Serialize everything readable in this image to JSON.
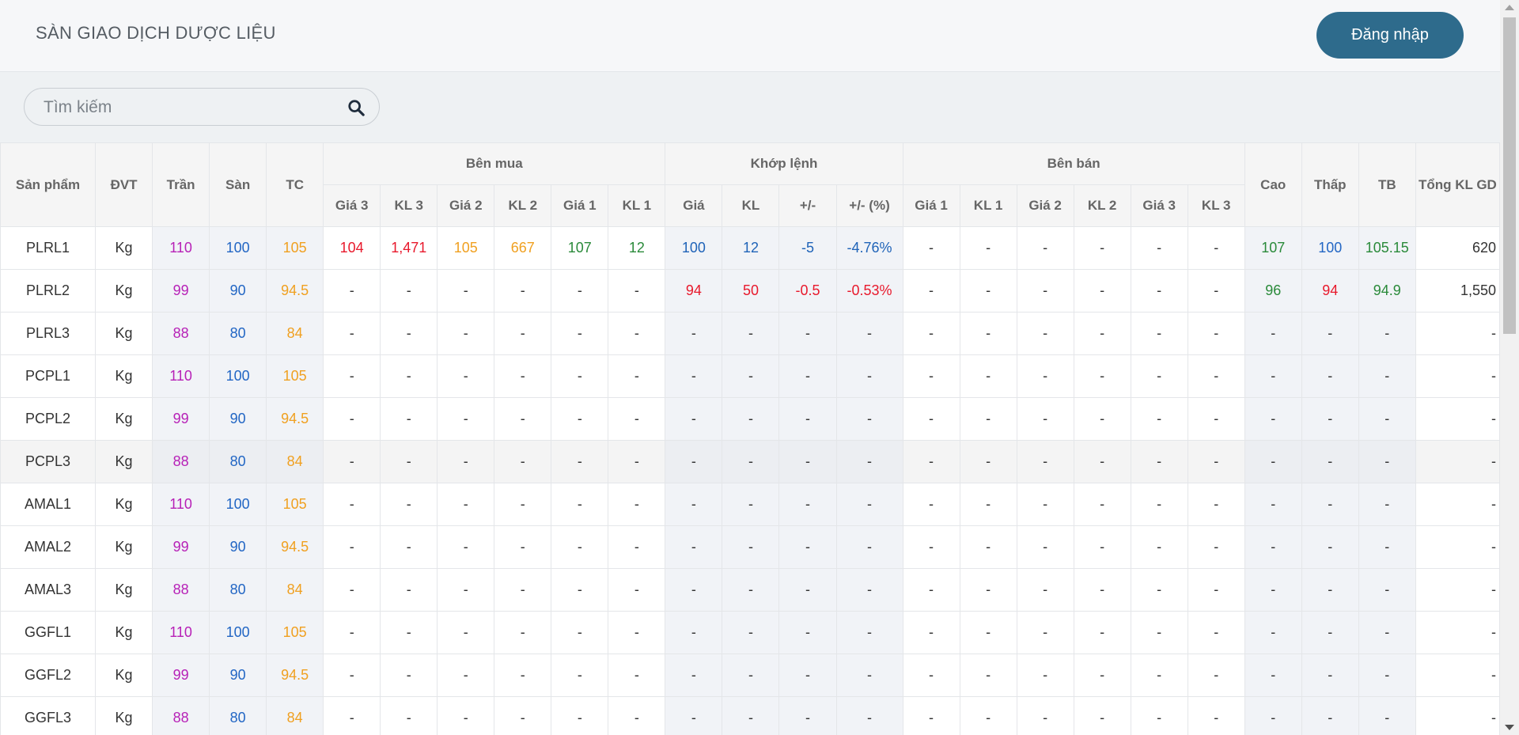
{
  "header": {
    "title": "SÀN GIAO DỊCH DƯỢC LIỆU",
    "login_label": "Đăng nhập"
  },
  "search": {
    "placeholder": "Tìm kiếm"
  },
  "table": {
    "group_headers": {
      "buy": "Bên mua",
      "match": "Khớp lệnh",
      "sell": "Bên bán"
    },
    "fixed_headers": {
      "product": "Sản phẩm",
      "unit": "ĐVT",
      "ceiling": "Trần",
      "floor": "Sàn",
      "ref": "TC",
      "high": "Cao",
      "low": "Thấp",
      "avg": "TB",
      "total": "Tổng KL GD"
    },
    "buy_cols": [
      "Giá 3",
      "KL 3",
      "Giá 2",
      "KL 2",
      "Giá 1",
      "KL 1"
    ],
    "match_cols": [
      "Giá",
      "KL",
      "+/-",
      "+/- (%)"
    ],
    "sell_cols": [
      "Giá 1",
      "KL 1",
      "Giá 2",
      "KL 2",
      "Giá 3",
      "KL 3"
    ],
    "rows": [
      {
        "product": "PLRL1",
        "unit": "Kg",
        "ceiling": "110",
        "floor": "100",
        "ref": "105",
        "buy": [
          "104",
          "1,471",
          "105",
          "667",
          "107",
          "12"
        ],
        "match": [
          "100",
          "12",
          "-5",
          "-4.76%"
        ],
        "sell": [
          "-",
          "-",
          "-",
          "-",
          "-",
          "-"
        ],
        "high": "107",
        "low": "100",
        "avg": "105.15",
        "total": "620"
      },
      {
        "product": "PLRL2",
        "unit": "Kg",
        "ceiling": "99",
        "floor": "90",
        "ref": "94.5",
        "buy": [
          "-",
          "-",
          "-",
          "-",
          "-",
          "-"
        ],
        "match": [
          "94",
          "50",
          "-0.5",
          "-0.53%"
        ],
        "sell": [
          "-",
          "-",
          "-",
          "-",
          "-",
          "-"
        ],
        "high": "96",
        "low": "94",
        "avg": "94.9",
        "total": "1,550"
      },
      {
        "product": "PLRL3",
        "unit": "Kg",
        "ceiling": "88",
        "floor": "80",
        "ref": "84",
        "buy": [
          "-",
          "-",
          "-",
          "-",
          "-",
          "-"
        ],
        "match": [
          "-",
          "-",
          "-",
          "-"
        ],
        "sell": [
          "-",
          "-",
          "-",
          "-",
          "-",
          "-"
        ],
        "high": "-",
        "low": "-",
        "avg": "-",
        "total": "-"
      },
      {
        "product": "PCPL1",
        "unit": "Kg",
        "ceiling": "110",
        "floor": "100",
        "ref": "105",
        "buy": [
          "-",
          "-",
          "-",
          "-",
          "-",
          "-"
        ],
        "match": [
          "-",
          "-",
          "-",
          "-"
        ],
        "sell": [
          "-",
          "-",
          "-",
          "-",
          "-",
          "-"
        ],
        "high": "-",
        "low": "-",
        "avg": "-",
        "total": "-"
      },
      {
        "product": "PCPL2",
        "unit": "Kg",
        "ceiling": "99",
        "floor": "90",
        "ref": "94.5",
        "buy": [
          "-",
          "-",
          "-",
          "-",
          "-",
          "-"
        ],
        "match": [
          "-",
          "-",
          "-",
          "-"
        ],
        "sell": [
          "-",
          "-",
          "-",
          "-",
          "-",
          "-"
        ],
        "high": "-",
        "low": "-",
        "avg": "-",
        "total": "-"
      },
      {
        "product": "PCPL3",
        "unit": "Kg",
        "ceiling": "88",
        "floor": "80",
        "ref": "84",
        "buy": [
          "-",
          "-",
          "-",
          "-",
          "-",
          "-"
        ],
        "match": [
          "-",
          "-",
          "-",
          "-"
        ],
        "sell": [
          "-",
          "-",
          "-",
          "-",
          "-",
          "-"
        ],
        "high": "-",
        "low": "-",
        "avg": "-",
        "total": "-"
      },
      {
        "product": "AMAL1",
        "unit": "Kg",
        "ceiling": "110",
        "floor": "100",
        "ref": "105",
        "buy": [
          "-",
          "-",
          "-",
          "-",
          "-",
          "-"
        ],
        "match": [
          "-",
          "-",
          "-",
          "-"
        ],
        "sell": [
          "-",
          "-",
          "-",
          "-",
          "-",
          "-"
        ],
        "high": "-",
        "low": "-",
        "avg": "-",
        "total": "-"
      },
      {
        "product": "AMAL2",
        "unit": "Kg",
        "ceiling": "99",
        "floor": "90",
        "ref": "94.5",
        "buy": [
          "-",
          "-",
          "-",
          "-",
          "-",
          "-"
        ],
        "match": [
          "-",
          "-",
          "-",
          "-"
        ],
        "sell": [
          "-",
          "-",
          "-",
          "-",
          "-",
          "-"
        ],
        "high": "-",
        "low": "-",
        "avg": "-",
        "total": "-"
      },
      {
        "product": "AMAL3",
        "unit": "Kg",
        "ceiling": "88",
        "floor": "80",
        "ref": "84",
        "buy": [
          "-",
          "-",
          "-",
          "-",
          "-",
          "-"
        ],
        "match": [
          "-",
          "-",
          "-",
          "-"
        ],
        "sell": [
          "-",
          "-",
          "-",
          "-",
          "-",
          "-"
        ],
        "high": "-",
        "low": "-",
        "avg": "-",
        "total": "-"
      },
      {
        "product": "GGFL1",
        "unit": "Kg",
        "ceiling": "110",
        "floor": "100",
        "ref": "105",
        "buy": [
          "-",
          "-",
          "-",
          "-",
          "-",
          "-"
        ],
        "match": [
          "-",
          "-",
          "-",
          "-"
        ],
        "sell": [
          "-",
          "-",
          "-",
          "-",
          "-",
          "-"
        ],
        "high": "-",
        "low": "-",
        "avg": "-",
        "total": "-"
      },
      {
        "product": "GGFL2",
        "unit": "Kg",
        "ceiling": "99",
        "floor": "90",
        "ref": "94.5",
        "buy": [
          "-",
          "-",
          "-",
          "-",
          "-",
          "-"
        ],
        "match": [
          "-",
          "-",
          "-",
          "-"
        ],
        "sell": [
          "-",
          "-",
          "-",
          "-",
          "-",
          "-"
        ],
        "high": "-",
        "low": "-",
        "avg": "-",
        "total": "-"
      },
      {
        "product": "GGFL3",
        "unit": "Kg",
        "ceiling": "88",
        "floor": "80",
        "ref": "84",
        "buy": [
          "-",
          "-",
          "-",
          "-",
          "-",
          "-"
        ],
        "match": [
          "-",
          "-",
          "-",
          "-"
        ],
        "sell": [
          "-",
          "-",
          "-",
          "-",
          "-",
          "-"
        ],
        "high": "-",
        "low": "-",
        "avg": "-",
        "total": "-"
      }
    ],
    "colors": {
      "ceiling": "#b721b7",
      "floor": "#2266c4",
      "ref": "#f0a020",
      "down": "#e8192c",
      "up": "#2a8a3a",
      "match_blue": "#1f63b8"
    }
  }
}
